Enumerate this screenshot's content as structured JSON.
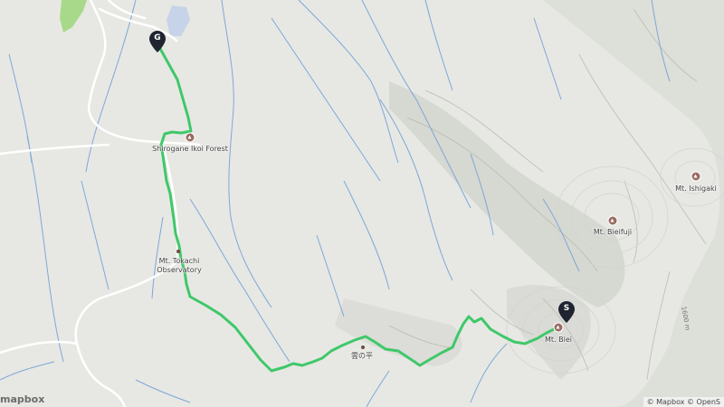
{
  "map": {
    "colors": {
      "land": "#e7e8e3",
      "water": "#7ea7d8",
      "route": "#3fc86a",
      "road": "#ffffff",
      "park": "#a8d98a",
      "pin": "#1f2430"
    },
    "places": {
      "shirogane": "Shirogane Ikoi Forest",
      "tokachi_obs_line1": "Mt. Tokachi",
      "tokachi_obs_line2": "Observatory",
      "kumonotaira": "雲の平",
      "mt_biei": "Mt. Biei",
      "mt_biei_fuji": "Mt. Bieifuji",
      "mt_ishigaki": "Mt. Ishigaki"
    },
    "markers": {
      "goal": "G",
      "start": "S"
    },
    "contour_label": "1600 m",
    "logo": "mapbox",
    "attribution": "© Mapbox © OpenS"
  }
}
